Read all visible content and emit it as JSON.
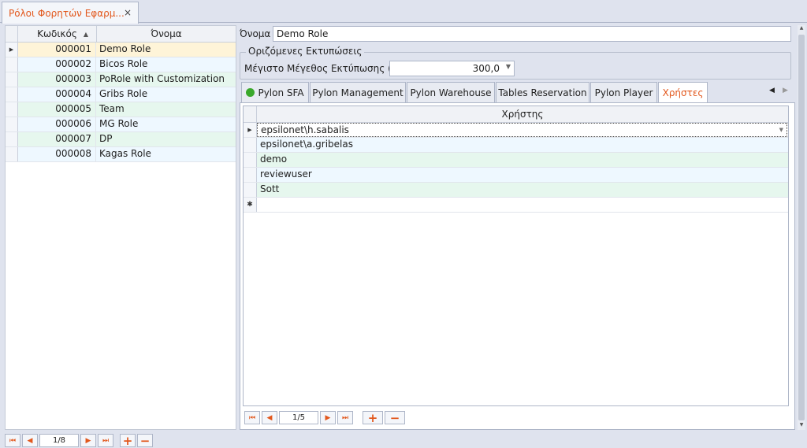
{
  "doc_tab": {
    "title": "Ρόλοι Φορητών Εφαρμ...",
    "close": "×"
  },
  "roles_grid": {
    "headers": {
      "code": "Κωδικός",
      "name": "Όνομα",
      "sort_glyph": "▲"
    },
    "rows": [
      {
        "code": "000001",
        "name": "Demo Role"
      },
      {
        "code": "000002",
        "name": "Bicos Role"
      },
      {
        "code": "000003",
        "name": "PoRole with Customization"
      },
      {
        "code": "000004",
        "name": "Gribs Role"
      },
      {
        "code": "000005",
        "name": "Team"
      },
      {
        "code": "000006",
        "name": "MG Role"
      },
      {
        "code": "000007",
        "name": "DP"
      },
      {
        "code": "000008",
        "name": "Kagas Role"
      }
    ],
    "navigator": {
      "position": "1/8"
    }
  },
  "detail": {
    "name_label": "Όνομα",
    "name_value": "Demo Role",
    "print_group": {
      "legend": "Οριζόμενες Εκτυπώσεις",
      "max_size_label": "Μέγιστο Μέγεθος Εκτύπωσης (kb)",
      "max_size_value": "300,0"
    },
    "tabs": [
      {
        "label": "Pylon SFA",
        "active": false
      },
      {
        "label": "Pylon Management",
        "active": false
      },
      {
        "label": "Pylon Warehouse",
        "active": false
      },
      {
        "label": "Tables Reservation",
        "active": false
      },
      {
        "label": "Pylon Player",
        "active": false
      },
      {
        "label": "Χρήστες",
        "active": true
      }
    ],
    "users_grid": {
      "header": "Χρήστης",
      "rows": [
        "epsilonet\\h.sabalis",
        "epsilonet\\a.gribelas",
        "demo",
        "reviewuser",
        "Sott"
      ],
      "new_row_glyph": "✱",
      "navigator": {
        "position": "1/5"
      }
    }
  },
  "colors": {
    "accent": "#e2571c",
    "row_alt": "#e6f7ee",
    "row_norm": "#eef8ff",
    "row_selected": "#fef4d8",
    "status_dot": "#3aa82b"
  }
}
